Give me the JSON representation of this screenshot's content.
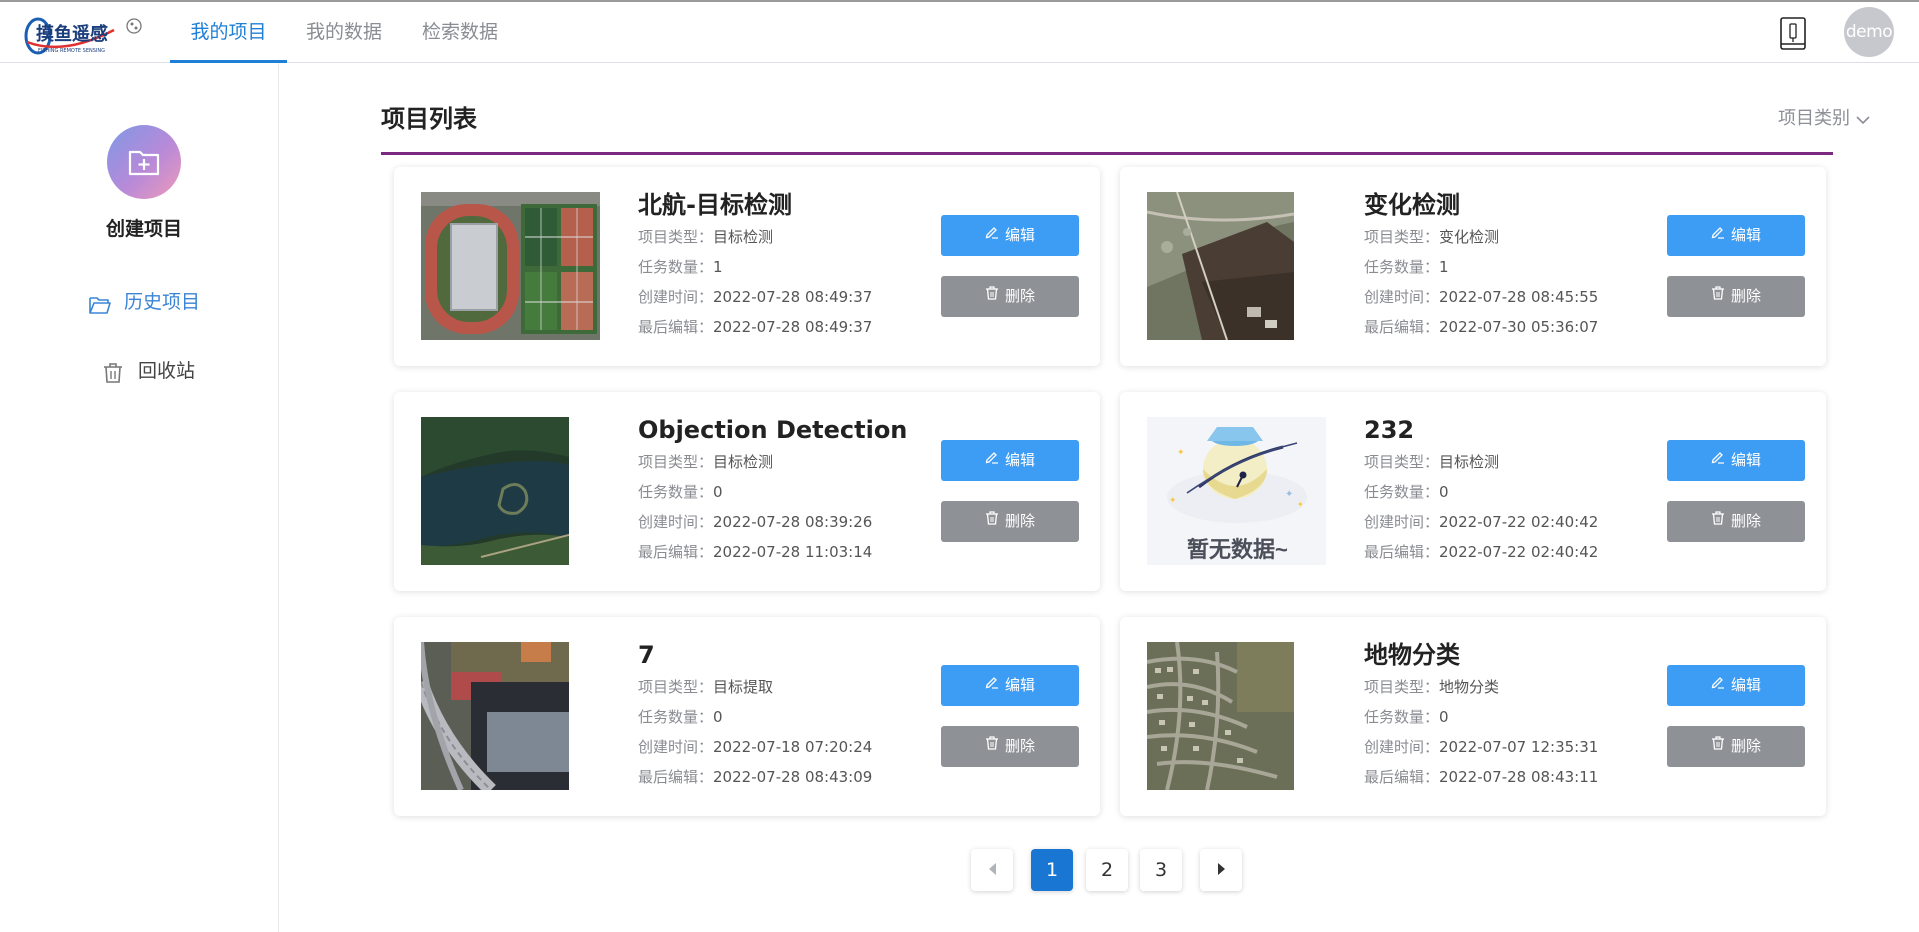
{
  "header": {
    "logo_text": "摸鱼遥感",
    "logo_subtext": "FISHING REMOTE SENSING",
    "tabs": [
      {
        "label": "我的项目",
        "active": true
      },
      {
        "label": "我的数据",
        "active": false
      },
      {
        "label": "检索数据",
        "active": false
      }
    ],
    "avatar_text": "demo",
    "accent_color": "#1f7fd6"
  },
  "sidebar": {
    "create_label": "创建项目",
    "items": [
      {
        "label": "历史项目",
        "icon": "folder-open-icon",
        "active": true
      },
      {
        "label": "回收站",
        "icon": "trash-icon",
        "active": false
      }
    ]
  },
  "main": {
    "title": "项目列表",
    "filter_label": "项目类别",
    "labels": {
      "type": "项目类型：",
      "tasks": "任务数量：",
      "created": "创建时间：",
      "edited": "最后编辑："
    },
    "edit_label": "编辑",
    "delete_label": "删除",
    "projects": [
      {
        "title": "北航-目标检测",
        "type": "目标检测",
        "tasks": "1",
        "created": "2022-07-28 08:49:37",
        "edited": "2022-07-28 08:49:37",
        "thumb": "sports-field"
      },
      {
        "title": "变化检测",
        "type": "变化检测",
        "tasks": "1",
        "created": "2022-07-28 08:45:55",
        "edited": "2022-07-30 05:36:07",
        "thumb": "farmland"
      },
      {
        "title": "Objection Detection",
        "type": "目标检测",
        "tasks": "0",
        "created": "2022-07-28 08:39:26",
        "edited": "2022-07-28 11:03:14",
        "thumb": "lake-forest"
      },
      {
        "title": "232",
        "type": "目标检测",
        "tasks": "0",
        "created": "2022-07-22 02:40:42",
        "edited": "2022-07-22 02:40:42",
        "thumb": "no-data",
        "thumb_text": "暂无数据~"
      },
      {
        "title": "7",
        "type": "目标提取",
        "tasks": "0",
        "created": "2022-07-18 07:20:24",
        "edited": "2022-07-28 08:43:09",
        "thumb": "urban-highway"
      },
      {
        "title": "地物分类",
        "type": "地物分类",
        "tasks": "0",
        "created": "2022-07-07 12:35:31",
        "edited": "2022-07-28 08:43:11",
        "thumb": "suburb"
      }
    ]
  },
  "pagination": {
    "pages": [
      "1",
      "2",
      "3"
    ],
    "current": "1"
  }
}
